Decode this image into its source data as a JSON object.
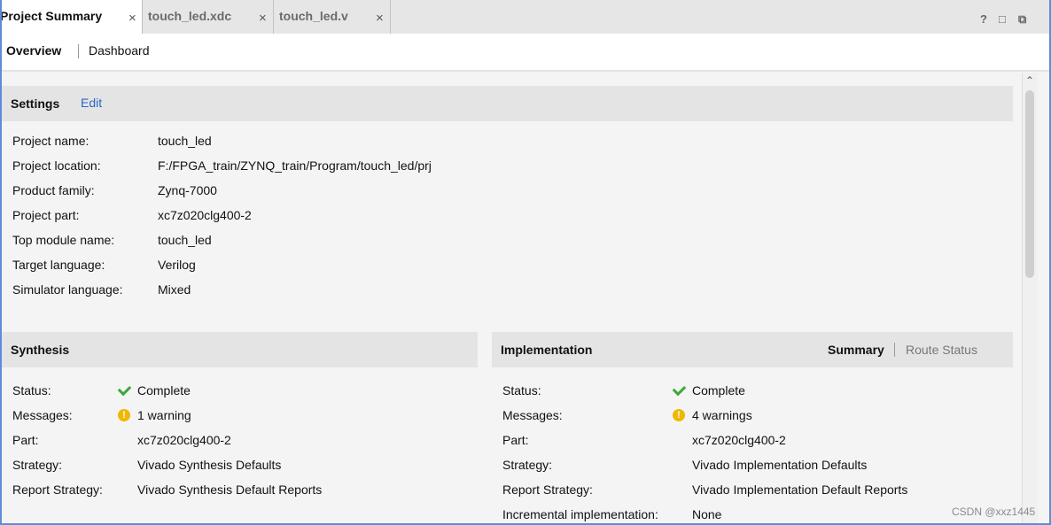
{
  "tabs": [
    {
      "label": "Project Summary",
      "close": "×",
      "active": true
    },
    {
      "label": "touch_led.xdc",
      "close": "×",
      "active": false
    },
    {
      "label": "touch_led.v",
      "close": "×",
      "active": false
    }
  ],
  "window_controls": {
    "help": "?",
    "restore": "□",
    "maximize": "⧉"
  },
  "subtabs": {
    "overview": "Overview",
    "dashboard": "Dashboard"
  },
  "settings": {
    "title": "Settings",
    "edit": "Edit",
    "rows": [
      {
        "key": "Project name:",
        "value": "touch_led",
        "link": false
      },
      {
        "key": "Project location:",
        "value": "F:/FPGA_train/ZYNQ_train/Program/touch_led/prj",
        "link": false
      },
      {
        "key": "Product family:",
        "value": "Zynq-7000",
        "link": false
      },
      {
        "key": "Project part:",
        "value": "xc7z020clg400-2",
        "link": true
      },
      {
        "key": "Top module name:",
        "value": "touch_led",
        "link": true
      },
      {
        "key": "Target language:",
        "value": "Verilog",
        "link": true
      },
      {
        "key": "Simulator language:",
        "value": "Mixed",
        "link": true
      }
    ]
  },
  "synthesis": {
    "title": "Synthesis",
    "status_key": "Status:",
    "status_value": "Complete",
    "messages_key": "Messages:",
    "messages_value": "1 warning",
    "part_key": "Part:",
    "part_value": "xc7z020clg400-2",
    "strategy_key": "Strategy:",
    "strategy_value": "Vivado Synthesis Defaults",
    "report_key": "Report Strategy:",
    "report_value": "Vivado Synthesis Default Reports"
  },
  "implementation": {
    "title": "Implementation",
    "tab_summary": "Summary",
    "tab_route": "Route Status",
    "status_key": "Status:",
    "status_value": "Complete",
    "messages_key": "Messages:",
    "messages_value": "4 warnings",
    "part_key": "Part:",
    "part_value": "xc7z020clg400-2",
    "strategy_key": "Strategy:",
    "strategy_value": "Vivado Implementation Defaults",
    "report_key": "Report Strategy:",
    "report_value": "Vivado Implementation Default Reports",
    "incremental_key": "Incremental implementation:",
    "incremental_value": "None"
  },
  "warning_glyph": "!",
  "scroll_up": "⌃",
  "watermark": "CSDN @xxz1445",
  "colors": {
    "accent": "#2a65c7",
    "ok": "#3aa83a",
    "warn": "#f0b800"
  }
}
